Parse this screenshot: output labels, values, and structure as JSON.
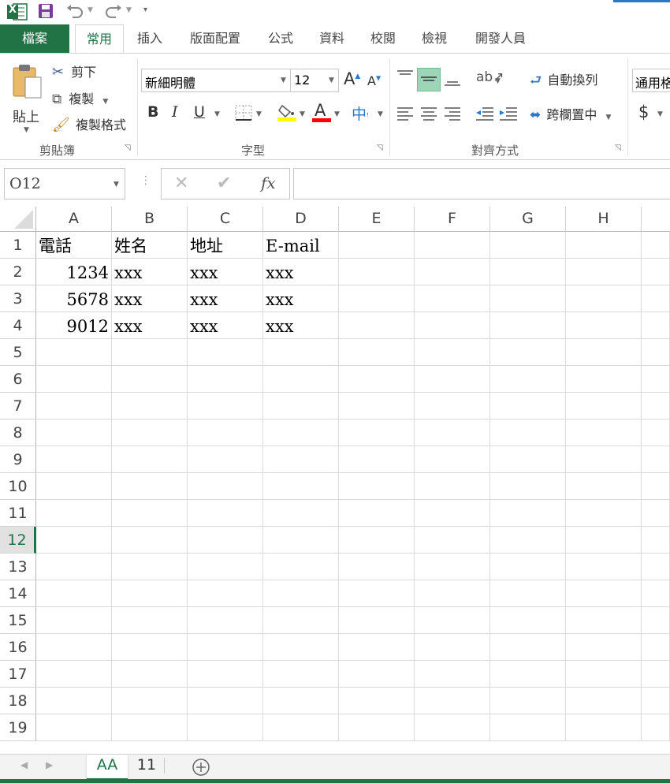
{
  "app": {
    "logo_letter": "X"
  },
  "tabs": [
    "檔案",
    "常用",
    "插入",
    "版面配置",
    "公式",
    "資料",
    "校閱",
    "檢視",
    "開發人員"
  ],
  "ribbon": {
    "clipboard": {
      "paste_label": "貼上",
      "cut_label": "剪下",
      "copy_label": "複製",
      "format_painter_label": "複製格式",
      "group_label": "剪貼簿"
    },
    "font": {
      "font_name": "新細明體",
      "font_size": "12",
      "bold": "B",
      "italic": "I",
      "underline": "U",
      "font_color_glyph": "A",
      "phonetic": "中",
      "group_label": "字型"
    },
    "alignment": {
      "wrap_text_label": "自動換列",
      "merge_center_label": "跨欄置中",
      "group_label": "對齊方式"
    },
    "number": {
      "format_value": "通用格式",
      "currency": "$"
    }
  },
  "formula_bar": {
    "name_box": "O12",
    "fx": "fx",
    "formula": ""
  },
  "columns": [
    "A",
    "B",
    "C",
    "D",
    "E",
    "F",
    "G",
    "H"
  ],
  "rows": [
    "1",
    "2",
    "3",
    "4",
    "5",
    "6",
    "7",
    "8",
    "9",
    "10",
    "11",
    "12",
    "13",
    "14",
    "15",
    "16",
    "17",
    "18",
    "19"
  ],
  "selected_row": "12",
  "cells": {
    "r1": [
      "電話",
      "姓名",
      "地址",
      "E-mail"
    ],
    "r2": [
      "1234",
      "xxx",
      "xxx",
      "xxx"
    ],
    "r3": [
      "5678",
      "xxx",
      "xxx",
      "xxx"
    ],
    "r4": [
      "9012",
      "xxx",
      "xxx",
      "xxx"
    ]
  },
  "sheets": [
    "AA",
    "11"
  ],
  "colors": {
    "excel_green": "#217346",
    "highlight_yellow": "#ffff00",
    "font_red": "#ff0000",
    "align_selected": "#9fd5b7"
  }
}
